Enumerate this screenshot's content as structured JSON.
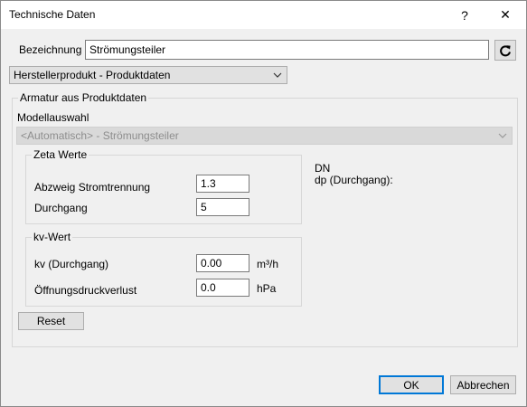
{
  "window": {
    "title": "Technische Daten",
    "help_glyph": "?",
    "close_glyph": "✕"
  },
  "bezeichnung": {
    "label": "Bezeichnung",
    "value": "Strömungsteiler"
  },
  "source_combo": {
    "value": "Herstellerprodukt - Produktdaten"
  },
  "armatur_group": {
    "legend": "Armatur aus Produktdaten",
    "modellauswahl_label": "Modellauswahl",
    "modell_value": "<Automatisch> - Strömungsteiler"
  },
  "zeta_group": {
    "legend": "Zeta Werte",
    "rows": [
      {
        "label": "Abzweig Stromtrennung",
        "value": "1.3"
      },
      {
        "label": "Durchgang",
        "value": "5"
      }
    ]
  },
  "kv_group": {
    "legend": "kv-Wert",
    "rows": [
      {
        "label": "kv (Durchgang)",
        "value": "0.00",
        "unit": "m³/h"
      },
      {
        "label": "Öffnungsdruckverlust",
        "value": "0.0",
        "unit": "hPa"
      }
    ]
  },
  "info": {
    "dn": "DN",
    "dp": "dp (Durchgang):"
  },
  "buttons": {
    "reset": "Reset",
    "ok": "OK",
    "cancel": "Abbrechen"
  }
}
